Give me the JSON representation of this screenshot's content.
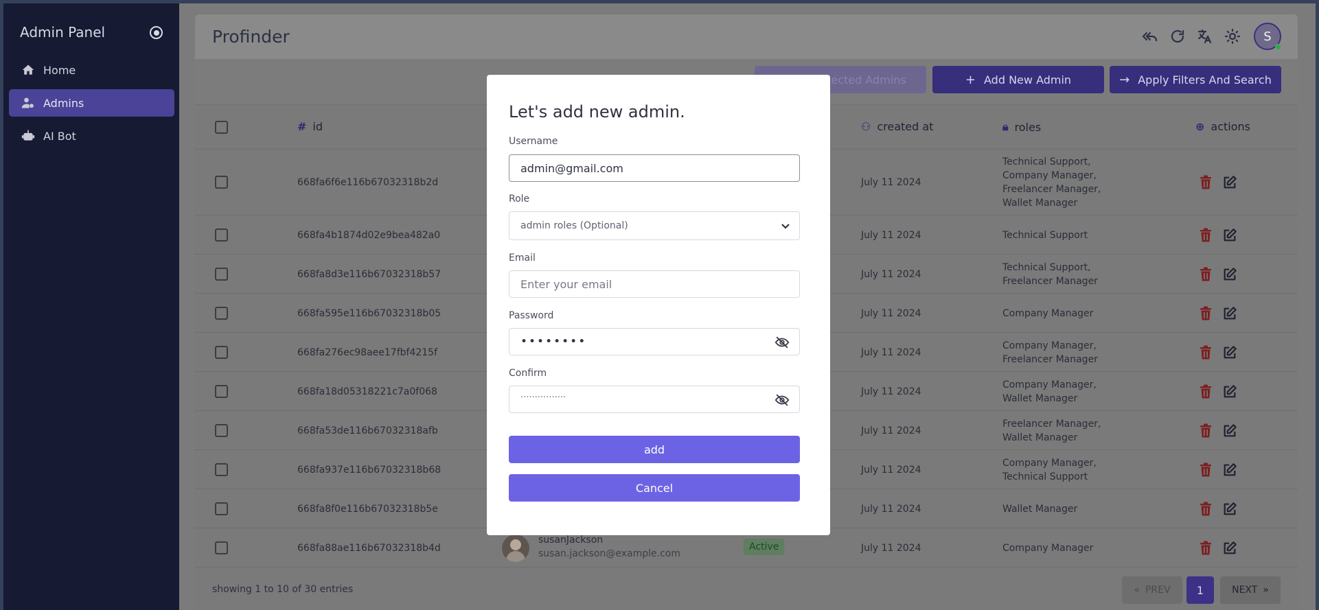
{
  "sidebar": {
    "title": "Admin Panel",
    "items": [
      {
        "label": "Home",
        "icon": "home-icon"
      },
      {
        "label": "Admins",
        "icon": "admin-user-icon"
      },
      {
        "label": "AI Bot",
        "icon": "robot-icon"
      }
    ]
  },
  "header": {
    "brand": "Profinder",
    "avatar_letter": "S",
    "icons": [
      "reply-all-icon",
      "refresh-icon",
      "translate-icon",
      "sun-icon"
    ]
  },
  "toolbar": {
    "delete_label": "Delete Selected Admins",
    "add_label": "Add New Admin",
    "apply_label": "Apply Filters And Search"
  },
  "table": {
    "columns": {
      "id": "id",
      "created_at": "created at",
      "roles": "roles",
      "actions": "actions"
    },
    "rows": [
      {
        "id": "668fa6f6e116b67032318b2d",
        "created": "July 11 2024",
        "roles": [
          "Technical Support,",
          "Company Manager,",
          "Freelancer Manager,",
          "Wallet Manager"
        ]
      },
      {
        "id": "668fa4b1874d02e9bea482a0",
        "created": "July 11 2024",
        "roles": [
          "Technical Support"
        ]
      },
      {
        "id": "668fa8d3e116b67032318b57",
        "created": "July 11 2024",
        "roles": [
          "Technical Support,",
          "Freelancer Manager"
        ]
      },
      {
        "id": "668fa595e116b67032318b05",
        "created": "July 11 2024",
        "roles": [
          "Company Manager"
        ]
      },
      {
        "id": "668fa276ec98aee17fbf4215f",
        "created": "July 11 2024",
        "roles": [
          "Company Manager,",
          "Freelancer Manager"
        ]
      },
      {
        "id": "668fa18d05318221c7a0f068",
        "created": "July 11 2024",
        "roles": [
          "Company Manager,",
          "Wallet Manager"
        ]
      },
      {
        "id": "668fa53de116b67032318afb",
        "created": "July 11 2024",
        "roles": [
          "Freelancer Manager,",
          "Wallet Manager"
        ]
      },
      {
        "id": "668fa937e116b67032318b68",
        "created": "July 11 2024",
        "roles": [
          "Company Manager,",
          "Technical Support"
        ]
      },
      {
        "id": "668fa8f0e116b67032318b5e",
        "created": "July 11 2024",
        "roles": [
          "Wallet Manager"
        ]
      },
      {
        "id": "668fa88ae116b67032318b4d",
        "created": "July 11 2024",
        "roles": [
          "Company Manager"
        ],
        "username": "susanJackson",
        "email": "susan.jackson@example.com",
        "status": "Active"
      }
    ]
  },
  "pagination": {
    "showing": "showing 1 to 10 of 30 entries",
    "prev": "PREV",
    "current": "1",
    "next": "NEXT"
  },
  "modal": {
    "title": "Let's add new admin.",
    "username_label": "Username",
    "username_value": "admin@gmail.com",
    "role_label": "Role",
    "role_placeholder": "admin roles (Optional)",
    "email_label": "Email",
    "email_placeholder": "Enter your email",
    "password_label": "Password",
    "password_mask": "••••••••",
    "confirm_label": "Confirm",
    "confirm_placeholder": "················",
    "add_label": "add",
    "cancel_label": "Cancel"
  },
  "colors": {
    "sidebar_bg": "#161a33",
    "accent": "#6c63e4",
    "active_item": "#4a4397"
  }
}
